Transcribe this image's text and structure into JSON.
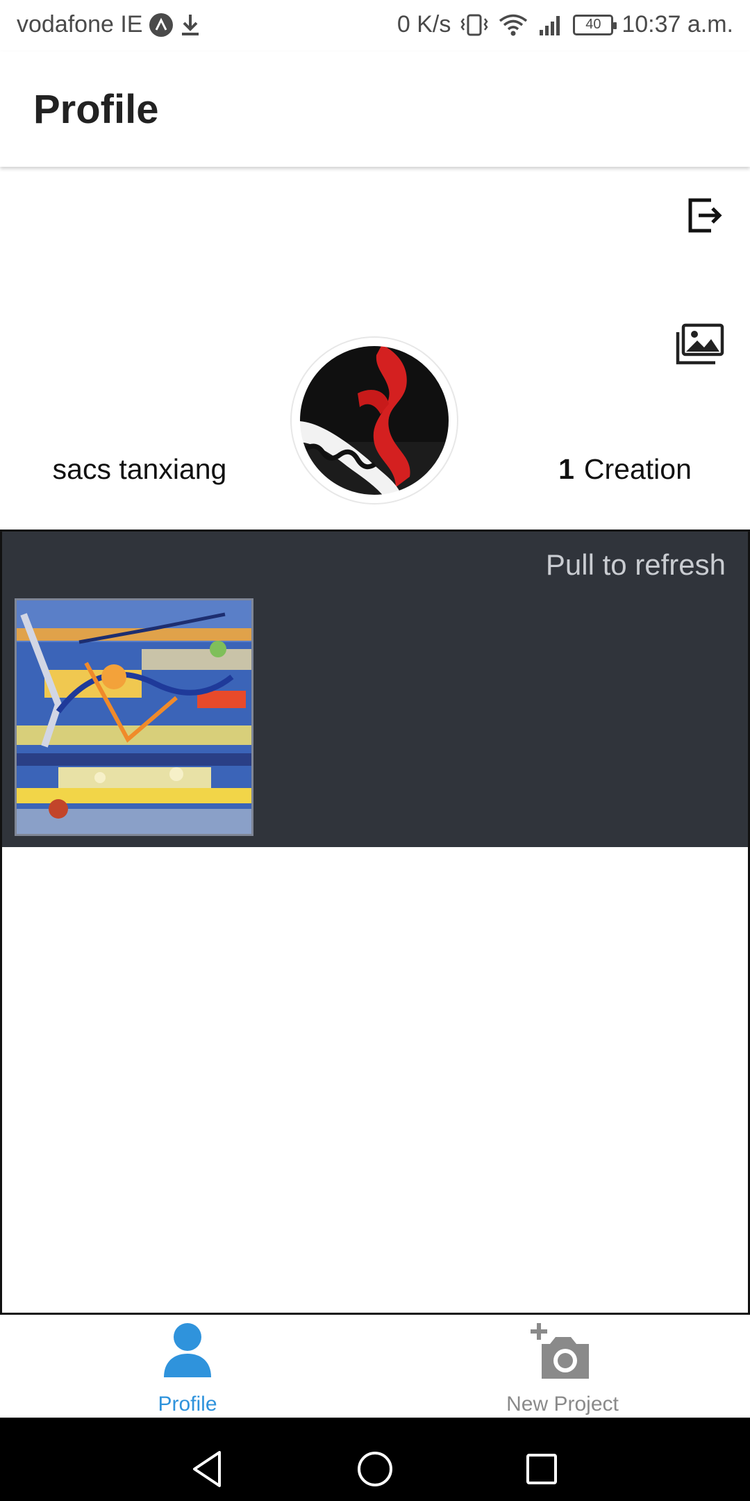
{
  "status_bar": {
    "carrier": "vodafone IE",
    "net_speed": "0 K/s",
    "battery": "40",
    "time": "10:37 a.m.",
    "icons": [
      "app-notification-icon",
      "download-icon",
      "vibrate-icon",
      "wifi-icon",
      "signal-icon",
      "battery-icon"
    ]
  },
  "app_bar": {
    "title": "Profile"
  },
  "profile": {
    "username": "sacs tanxiang",
    "creation_count": "1",
    "creation_label": "Creation",
    "icons": {
      "logout": "logout-icon",
      "gallery": "gallery-icon",
      "avatar": "avatar-image"
    }
  },
  "feed": {
    "pull_to_refresh": "Pull to refresh",
    "background_color": "#30343b",
    "items": [
      {
        "type": "artwork-thumbnail"
      }
    ]
  },
  "bottom_nav": {
    "items": [
      {
        "label": "Profile",
        "icon": "person-icon",
        "active": true,
        "color": "#2f93dc"
      },
      {
        "label": "New Project",
        "icon": "add-camera-icon",
        "active": false,
        "color": "#8a8a8a"
      }
    ]
  },
  "system_nav": {
    "buttons": [
      "back-icon",
      "home-icon",
      "recents-icon"
    ]
  }
}
